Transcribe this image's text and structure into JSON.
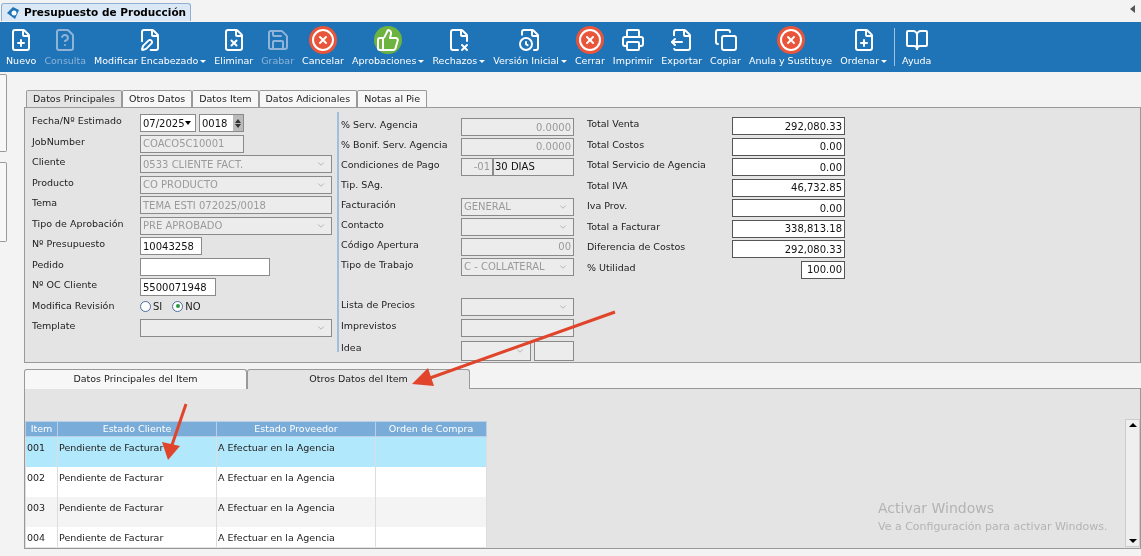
{
  "window": {
    "title": "Presupuesto de Producción"
  },
  "toolbar": [
    {
      "label": "Nuevo",
      "disabled": false,
      "dropdown": false
    },
    {
      "label": "Consulta",
      "disabled": true,
      "dropdown": false
    },
    {
      "label": "Modificar Encabezado",
      "disabled": false,
      "dropdown": true
    },
    {
      "label": "Eliminar",
      "disabled": false,
      "dropdown": false
    },
    {
      "label": "Grabar",
      "disabled": true,
      "dropdown": false
    },
    {
      "label": "Cancelar",
      "disabled": false,
      "dropdown": false
    },
    {
      "label": "Aprobaciones",
      "disabled": false,
      "dropdown": true
    },
    {
      "label": "Rechazos",
      "disabled": false,
      "dropdown": true
    },
    {
      "label": "Versión Inicial",
      "disabled": false,
      "dropdown": true
    },
    {
      "label": "Cerrar",
      "disabled": false,
      "dropdown": false
    },
    {
      "label": "Imprimir",
      "disabled": false,
      "dropdown": false
    },
    {
      "label": "Exportar",
      "disabled": false,
      "dropdown": false
    },
    {
      "label": "Copiar",
      "disabled": false,
      "dropdown": false
    },
    {
      "label": "Anula y Sustituye",
      "disabled": false,
      "dropdown": false
    },
    {
      "label": "Ordenar",
      "disabled": false,
      "dropdown": true
    },
    {
      "label": "Ayuda",
      "disabled": false,
      "dropdown": false
    }
  ],
  "tabs": [
    {
      "label": "Datos Principales",
      "selected": true
    },
    {
      "label": "Otros Datos",
      "selected": false
    },
    {
      "label": "Datos Item",
      "selected": false
    },
    {
      "label": "Datos Adicionales",
      "selected": false
    },
    {
      "label": "Notas al Pie",
      "selected": false
    }
  ],
  "left_fields": [
    {
      "label": "Fecha/Nº Estimado",
      "kind": "date",
      "value": "07/2025",
      "number": "0018",
      "disabled": false
    },
    {
      "label": "JobNumber",
      "kind": "text",
      "value": "COACO5C10001",
      "disabled": true
    },
    {
      "label": "Cliente",
      "kind": "select",
      "value": "0533 CLIENTE FACT.",
      "disabled": true
    },
    {
      "label": "Producto",
      "kind": "select",
      "value": "CO PRODUCTO",
      "disabled": true
    },
    {
      "label": "Tema",
      "kind": "text",
      "value": "TEMA ESTI 072025/0018",
      "disabled": true
    },
    {
      "label": "Tipo de Aprobación",
      "kind": "select",
      "value": "PRE APROBADO",
      "disabled": true
    },
    {
      "label": "Nº Presupuesto",
      "kind": "text",
      "value": "10043258",
      "disabled": false
    },
    {
      "label": "Pedido",
      "kind": "text",
      "disabled": false
    },
    {
      "label": "Nº OC Cliente",
      "kind": "text",
      "value": "5500071948",
      "disabled": false
    },
    {
      "label": "Modifica Revisión",
      "kind": "radio",
      "options": [
        {
          "label": "SI",
          "selected": false
        },
        {
          "label": "NO",
          "selected": true
        }
      ]
    },
    {
      "label": "Template",
      "kind": "select",
      "disabled": true
    }
  ],
  "middle_fields": [
    {
      "label": "% Serv. Agencia",
      "kind": "number",
      "value": "0.0000",
      "disabled": true
    },
    {
      "label": "% Bonif. Serv. Agencia",
      "kind": "number",
      "value": "0.0000",
      "disabled": true
    },
    {
      "label": "Condiciones de Pago",
      "kind": "split",
      "code": "-01",
      "value": "30 DIAS",
      "disabled": true
    },
    {
      "label": "Tip. SAg.",
      "kind": "none"
    },
    {
      "label": "Facturación",
      "kind": "select",
      "value": "GENERAL",
      "disabled": true
    },
    {
      "label": "Contacto",
      "kind": "select",
      "disabled": true
    },
    {
      "label": "Código Apertura",
      "kind": "number",
      "value": "00",
      "disabled": true
    },
    {
      "label": "Tipo de Trabajo",
      "kind": "select",
      "value": "C - COLLATERAL",
      "disabled": true
    },
    {
      "label": "Lista de Precios",
      "kind": "select",
      "disabled": true
    },
    {
      "label": "Imprevistos",
      "kind": "text",
      "disabled": true
    },
    {
      "label": "Idea",
      "kind": "select-box",
      "disabled": true
    }
  ],
  "totals": [
    {
      "label": "Total Venta",
      "value": "292,080.33"
    },
    {
      "label": "Total Costos",
      "value": "0.00"
    },
    {
      "label": "Total Servicio de Agencia",
      "value": "0.00"
    },
    {
      "label": "Total IVA",
      "value": "46,732.85"
    },
    {
      "label": "Iva Prov.",
      "value": "0.00"
    },
    {
      "label": "Total a Facturar",
      "value": "338,813.18"
    },
    {
      "label": "Diferencia de Costos",
      "value": "292,080.33"
    },
    {
      "label": "% Utilidad",
      "value": "100.00"
    }
  ],
  "item_tabs": [
    {
      "label": "Datos Principales del Item",
      "selected": false
    },
    {
      "label": "Otros Datos del Item",
      "selected": true
    }
  ],
  "table": {
    "columns": [
      "Item",
      "Estado Cliente",
      "Estado Proveedor",
      "Orden de Compra"
    ],
    "rows": [
      {
        "cells": [
          "001",
          "Pendiente de Facturar",
          "A Efectuar en la Agencia"
        ],
        "selected": true
      },
      {
        "cells": [
          "002",
          "Pendiente de Facturar",
          "A Efectuar en la Agencia"
        ],
        "selected": false
      },
      {
        "cells": [
          "003",
          "Pendiente de Facturar",
          "A Efectuar en la Agencia"
        ],
        "selected": false
      },
      {
        "cells": [
          "004",
          "Pendiente de Facturar",
          "A Efectuar en la Agencia"
        ],
        "selected": false
      }
    ]
  },
  "os_notice": {
    "title": "Activar Windows",
    "text": "Ve a Configuración para activar Windows."
  }
}
